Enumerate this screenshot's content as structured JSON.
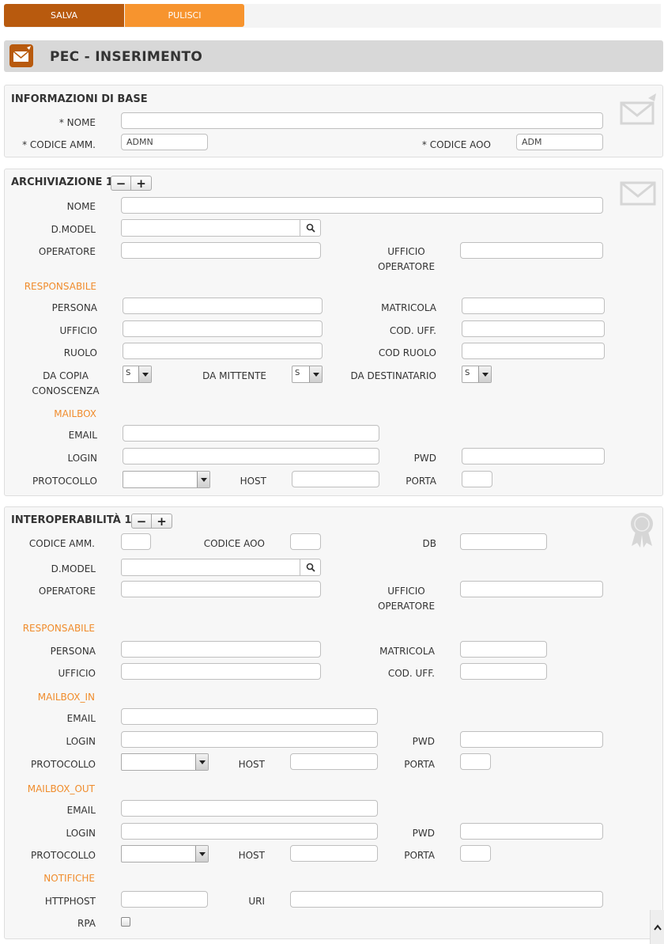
{
  "toolbar": {
    "save_label": "SALVA",
    "clear_label": "PULISCI"
  },
  "header": {
    "title": "PEC - INSERIMENTO"
  },
  "base": {
    "title": "INFORMAZIONI DI BASE",
    "nome_label": "* NOME",
    "codice_amm_label": "* CODICE AMM.",
    "codice_amm_value": "ADMN",
    "codice_aoo_label": "* CODICE AOO",
    "codice_aoo_value": "ADM"
  },
  "archiviazione": {
    "title": "ARCHIVIAZIONE 1",
    "nome_label": "NOME",
    "dmodel_label": "D.MODEL",
    "operatore_label": "OPERATORE",
    "ufficio_operatore_label": "UFFICIO OPERATORE",
    "responsabile_label": "RESPONSABILE",
    "persona_label": "PERSONA",
    "matricola_label": "MATRICOLA",
    "ufficio_label": "UFFICIO",
    "cod_uff_label": "COD. UFF.",
    "ruolo_label": "RUOLO",
    "cod_ruolo_label": "COD RUOLO",
    "da_copia_label": "DA COPIA CONOSCENZA",
    "da_mittente_label": "DA MITTENTE",
    "da_destinatario_label": "DA DESTINATARIO",
    "da_copia_value": "S",
    "da_mittente_value": "S",
    "da_destinatario_value": "S",
    "mailbox_label": "MAILBOX",
    "email_label": "EMAIL",
    "login_label": "LOGIN",
    "pwd_label": "PWD",
    "protocollo_label": "PROTOCOLLO",
    "host_label": "HOST",
    "porta_label": "PORTA"
  },
  "interop": {
    "title": "INTEROPERABILITÀ 1",
    "codice_amm_label": "CODICE AMM.",
    "codice_aoo_label": "CODICE AOO",
    "db_label": "DB",
    "dmodel_label": "D.MODEL",
    "operatore_label": "OPERATORE",
    "ufficio_operatore_label": "UFFICIO OPERATORE",
    "responsabile_label": "RESPONSABILE",
    "persona_label": "PERSONA",
    "matricola_label": "MATRICOLA",
    "ufficio_label": "UFFICIO",
    "cod_uff_label": "COD. UFF.",
    "mailbox_in_label": "MAILBOX_IN",
    "mailbox_out_label": "MAILBOX_OUT",
    "email_label": "EMAIL",
    "login_label": "LOGIN",
    "pwd_label": "PWD",
    "protocollo_label": "PROTOCOLLO",
    "host_label": "HOST",
    "porta_label": "PORTA",
    "notifiche_label": "NOTIFICHE",
    "httphost_label": "HTTPHOST",
    "uri_label": "URI",
    "rpa_label": "RPA"
  },
  "icons": {
    "header": "envelope-icon",
    "base": "envelope-edit-icon",
    "archiviazione": "envelope-icon",
    "interop": "award-badge-icon",
    "search": "search-icon",
    "scroll": "chevron-up-icon"
  },
  "colors": {
    "primary": "#b85a0e",
    "accent": "#f7942e",
    "subheading": "#f08c2c"
  }
}
